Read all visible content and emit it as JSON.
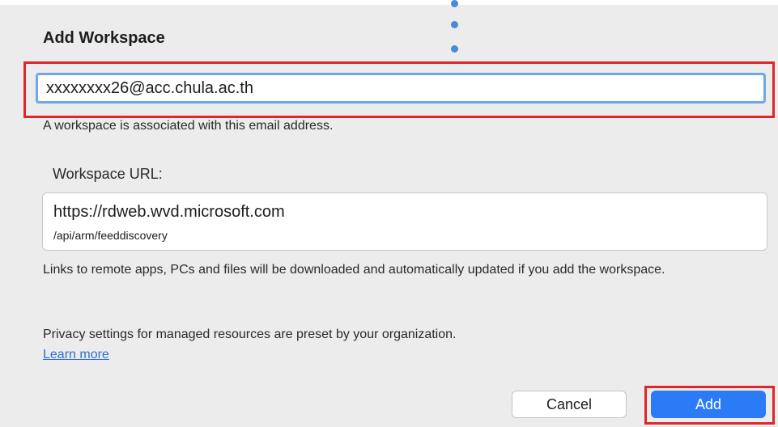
{
  "dialog": {
    "title": "Add Workspace",
    "email": {
      "value": "xxxxxxxx26@acc.chula.ac.th",
      "hint": "A workspace is associated with this email address."
    },
    "workspace_url": {
      "label": "Workspace URL:",
      "line1": "https://rdweb.wvd.microsoft.com",
      "line2": "/api/arm/feeddiscovery"
    },
    "description": "Links to remote apps, PCs and files will be downloaded and automatically updated if you add the workspace.",
    "privacy": "Privacy settings for managed resources are preset by your organization.",
    "learn_more": "Learn more",
    "buttons": {
      "cancel": "Cancel",
      "add": "Add"
    }
  },
  "colors": {
    "accent": "#2a7bf5",
    "highlight": "#e0262a",
    "link": "#2f6fd0",
    "focus_ring": "#6ea7ec"
  }
}
